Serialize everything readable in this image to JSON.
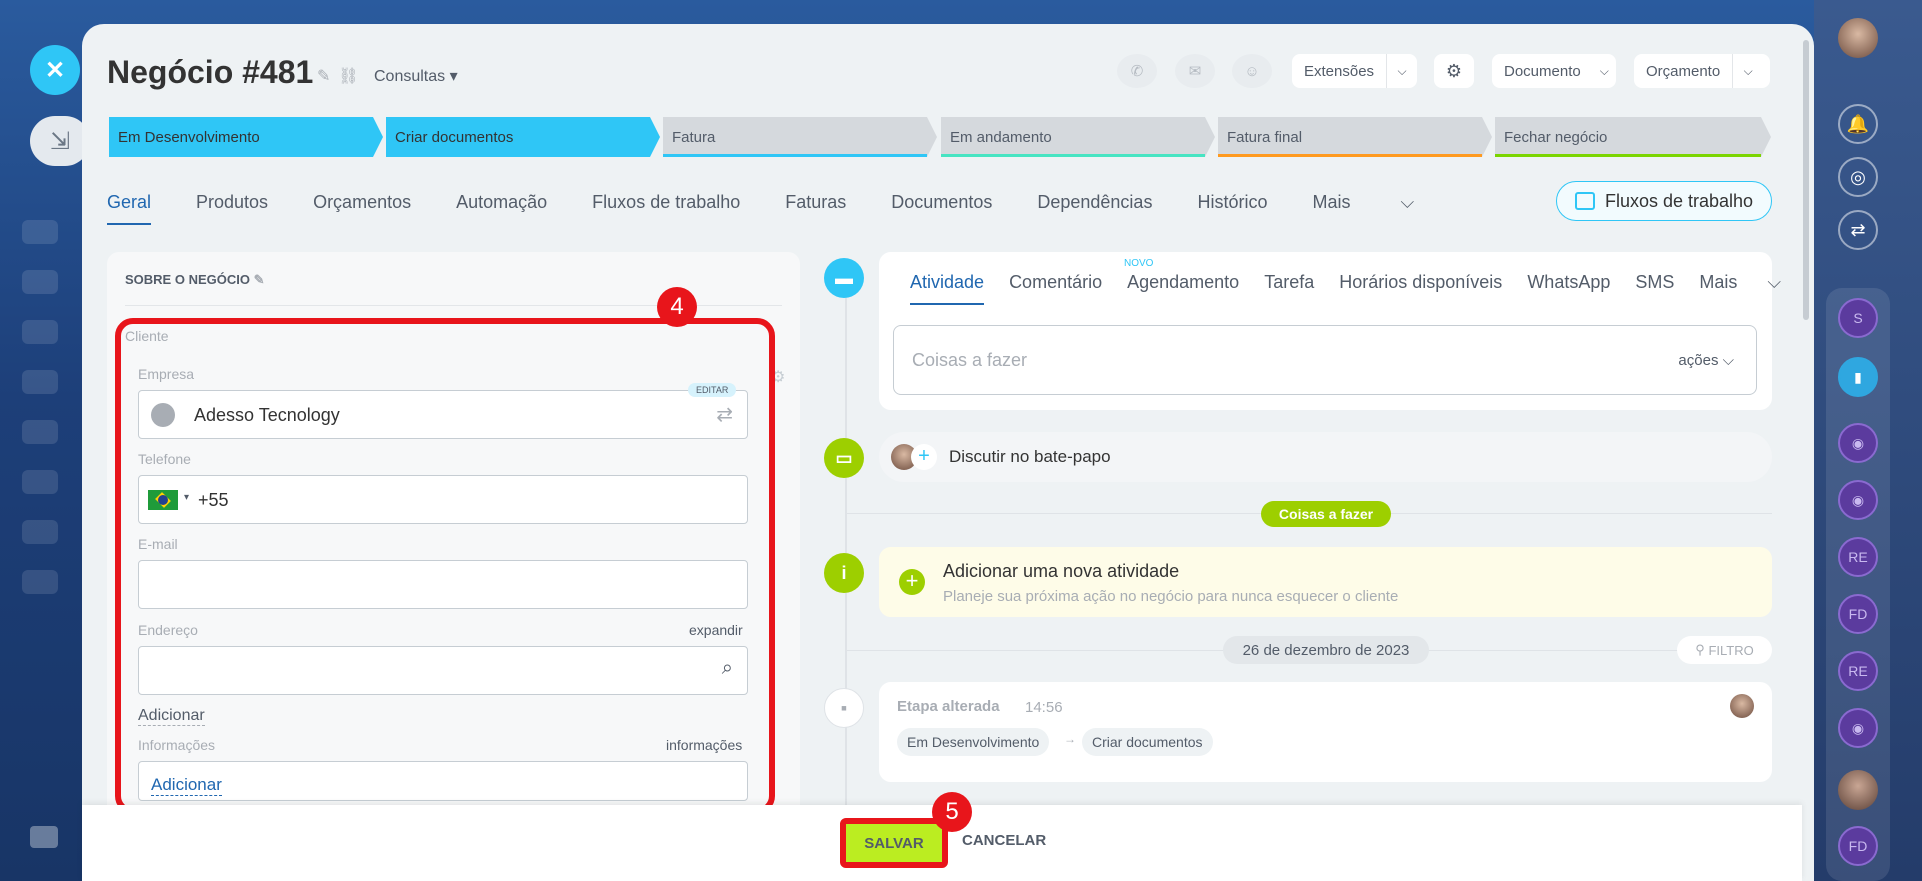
{
  "header": {
    "title": "Negócio #481",
    "category": "Consultas",
    "toolbar": {
      "extensions": "Extensões",
      "document": "Documento",
      "quote": "Orçamento"
    }
  },
  "stages": [
    {
      "label": "Em Desenvolvimento",
      "color": "#2fc6f6"
    },
    {
      "label": "Criar documentos",
      "color": "#2fc6f6"
    },
    {
      "label": "Fatura",
      "color": "#2fc6f6"
    },
    {
      "label": "Em andamento",
      "color": "#47e4c2"
    },
    {
      "label": "Fatura final",
      "color": "#ff9a1f"
    },
    {
      "label": "Fechar negócio",
      "color": "#7bd500"
    }
  ],
  "tabs": [
    "Geral",
    "Produtos",
    "Orçamentos",
    "Automação",
    "Fluxos de trabalho",
    "Faturas",
    "Documentos",
    "Dependências",
    "Histórico",
    "Mais"
  ],
  "workflows_button": "Fluxos de trabalho",
  "about": {
    "title": "SOBRE O NEGÓCIO",
    "client_label": "Cliente",
    "company_label": "Empresa",
    "edit_badge": "EDITAR",
    "company_value": "Adesso Tecnology",
    "phone_label": "Telefone",
    "phone_prefix": "+55",
    "email_label": "E-mail",
    "address_label": "Endereço",
    "expand": "expandir",
    "add": "Adicionar",
    "info_label": "Informações",
    "info_link": "informações",
    "info_add": "Adicionar"
  },
  "activity": {
    "tabs": [
      "Atividade",
      "Comentário",
      "Agendamento",
      "Tarefa",
      "Horários disponíveis",
      "WhatsApp",
      "SMS",
      "Mais"
    ],
    "new_badge": "NOVO",
    "todo_placeholder": "Coisas a fazer",
    "actions": "ações",
    "chat": "Discutir no bate-papo",
    "todo_pill": "Coisas a fazer",
    "new_title": "Adicionar uma nova atividade",
    "new_sub": "Planeje sua próxima ação no negócio para nunca esquecer o cliente",
    "date": "26 de dezembro de 2023",
    "filter": "FILTRO",
    "history_title": "Etapa alterada",
    "history_time": "14:56",
    "history_from": "Em Desenvolvimento",
    "history_to": "Criar documentos"
  },
  "annotations": {
    "box4": "4",
    "box5": "5"
  },
  "footer": {
    "save": "SALVAR",
    "cancel": "CANCELAR"
  },
  "rail": {
    "items": [
      "S",
      "RE",
      "FD",
      "RE",
      "FD"
    ]
  }
}
